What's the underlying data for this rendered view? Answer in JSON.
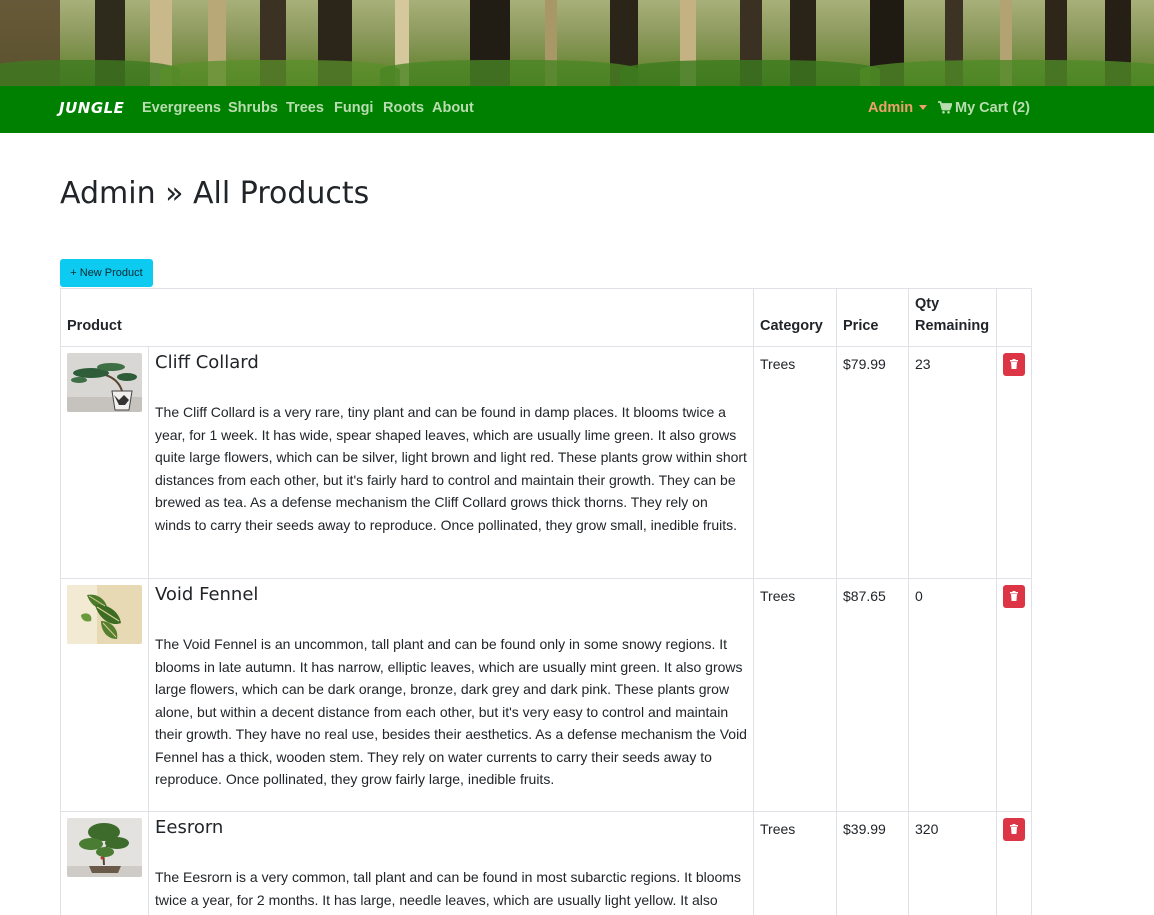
{
  "navbar": {
    "brand": "JUNGLE",
    "links": [
      "Evergreens",
      "Shrubs",
      "Trees",
      "Fungi",
      "Roots",
      "About"
    ],
    "admin_label": "Admin",
    "cart_label": "My Cart (2)"
  },
  "page": {
    "title": "Admin » All Products",
    "new_product_label": "+ New Product"
  },
  "table": {
    "headers": {
      "product": "Product",
      "category": "Category",
      "price": "Price",
      "qty_line1": "Qty",
      "qty_line2": "Remaining"
    },
    "rows": [
      {
        "name": "Cliff Collard",
        "description": "The Cliff Collard is a very rare, tiny plant and can be found in damp places. It blooms twice a year, for 1 week. It has wide, spear shaped leaves, which are usually lime green. It also grows quite large flowers, which can be silver, light brown and light red. These plants grow within short distances from each other, but it's fairly hard to control and maintain their growth. They can be brewed as tea. As a defense mechanism the Cliff Collard grows thick thorns. They rely on winds to carry their seeds away to reproduce. Once pollinated, they grow small, inedible fruits.",
        "category": "Trees",
        "price": "$79.99",
        "qty": "23"
      },
      {
        "name": "Void Fennel",
        "description": "The Void Fennel is an uncommon, tall plant and can be found only in some snowy regions. It blooms in late autumn. It has narrow, elliptic leaves, which are usually mint green. It also grows large flowers, which can be dark orange, bronze, dark grey and dark pink. These plants grow alone, but within a decent distance from each other, but it's very easy to control and maintain their growth. They have no real use, besides their aesthetics. As a defense mechanism the Void Fennel has a thick, wooden stem. They rely on water currents to carry their seeds away to reproduce. Once pollinated, they grow fairly large, inedible fruits.",
        "category": "Trees",
        "price": "$87.65",
        "qty": "0"
      },
      {
        "name": "Eesrorn",
        "description": "The Eesrorn is a very common, tall plant and can be found in most subarctic regions. It blooms twice a year, for 2 months. It has large, needle leaves, which are usually light yellow. It also",
        "category": "Trees",
        "price": "$39.99",
        "qty": "320"
      }
    ]
  },
  "colors": {
    "navbar": "#008000",
    "nav_link": "#b9dcb0",
    "admin_link": "#f0a070",
    "new_button": "#0dcaf0",
    "delete_button": "#dc3545"
  },
  "icons": {
    "cart": "cart-icon",
    "delete": "trash-icon",
    "dropdown": "chevron-down-icon"
  }
}
